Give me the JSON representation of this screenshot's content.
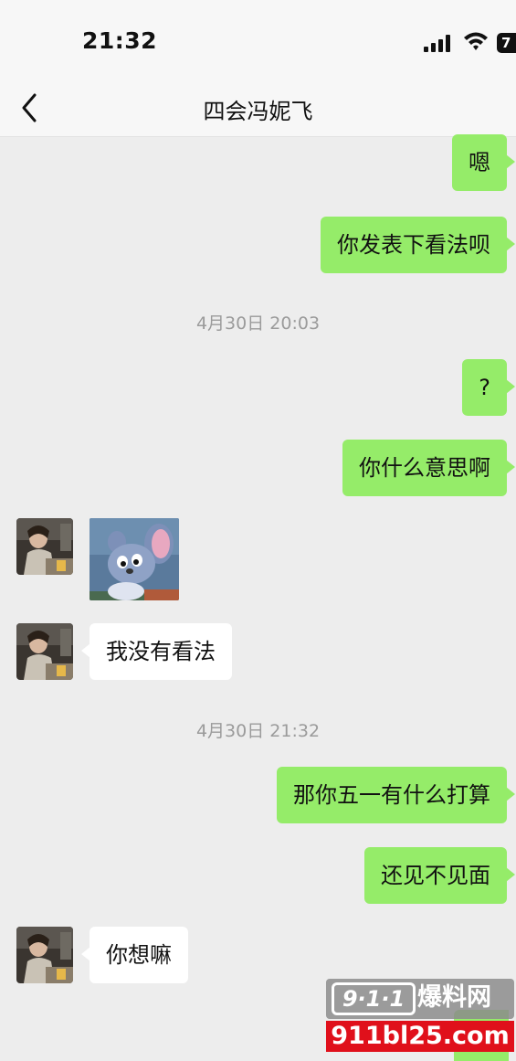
{
  "status_bar": {
    "time": "21:32",
    "battery": "7"
  },
  "nav": {
    "title": "四会冯妮飞"
  },
  "messages": [
    {
      "side": "out",
      "text": "嗯"
    },
    {
      "side": "out",
      "text": "你发表下看法呗"
    },
    {
      "side": "time",
      "text": "4月30日 20:03"
    },
    {
      "side": "out",
      "text": "?"
    },
    {
      "side": "out",
      "text": "你什么意思啊"
    },
    {
      "side": "in",
      "type": "sticker"
    },
    {
      "side": "in",
      "text": "我没有看法"
    },
    {
      "side": "time",
      "text": "4月30日 21:32"
    },
    {
      "side": "out",
      "text": "那你五一有什么打算"
    },
    {
      "side": "out",
      "text": "还见不见面"
    },
    {
      "side": "in",
      "text": "你想嘛"
    }
  ],
  "watermark": {
    "logo": "9·1·1",
    "brand": "爆料网",
    "domain": "911bl25.com"
  },
  "colors": {
    "outgoing_bubble": "#95ec69",
    "incoming_bubble": "#ffffff",
    "background": "#ededed",
    "watermark_red": "#e0101b"
  }
}
